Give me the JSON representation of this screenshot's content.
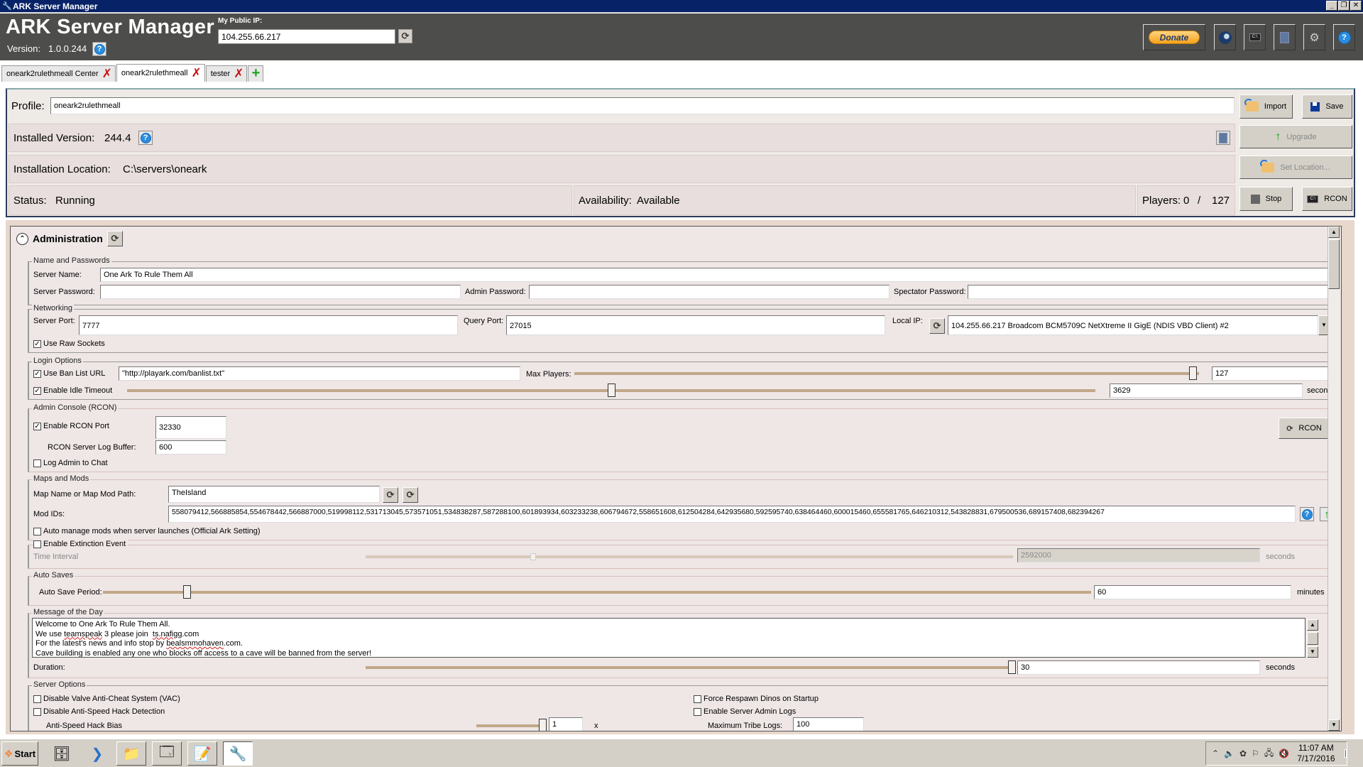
{
  "window": {
    "title": "ARK Server Manager",
    "controls": [
      "minimize",
      "restore",
      "close"
    ]
  },
  "header": {
    "app_title": "ARK Server Manager",
    "version_label": "Version:",
    "version_value": "1.0.0.244",
    "public_ip_label": "My Public IP:",
    "public_ip_value": "104.255.66.217",
    "donate_label": "Donate",
    "toolbar_icons": [
      "steam-icon",
      "console-icon",
      "notes-icon",
      "settings-icon",
      "help-icon"
    ]
  },
  "tabs": [
    {
      "label": "oneark2rulethmeall Center",
      "active": false
    },
    {
      "label": "oneark2rulethmeall",
      "active": true
    },
    {
      "label": "tester",
      "active": false
    }
  ],
  "profile": {
    "profile_label": "Profile:",
    "profile_value": "oneark2rulethmeall",
    "import_label": "Import",
    "save_label": "Save",
    "installed_version_label": "Installed Version:",
    "installed_version_value": "244.4",
    "upgrade_label": "Upgrade",
    "installation_location_label": "Installation Location:",
    "installation_location_value": "C:\\servers\\oneark",
    "set_location_label": "Set Location...",
    "status_label": "Status:",
    "status_value": "Running",
    "availability_label": "Availability:",
    "availability_value": "Available",
    "players_label": "Players:",
    "players_current": "0",
    "players_sep": "/",
    "players_max": "127",
    "stop_label": "Stop",
    "rcon_label": "RCON"
  },
  "administration": {
    "title": "Administration",
    "name_passwords": {
      "legend": "Name and Passwords",
      "server_name_label": "Server Name:",
      "server_name_value": "One Ark To Rule Them All",
      "server_password_label": "Server Password:",
      "server_password_value": "",
      "admin_password_label": "Admin Password:",
      "admin_password_value": "",
      "spectator_password_label": "Spectator Password:",
      "spectator_password_value": ""
    },
    "networking": {
      "legend": "Networking",
      "server_port_label": "Server Port:",
      "server_port_value": "7777",
      "query_port_label": "Query Port:",
      "query_port_value": "27015",
      "local_ip_label": "Local IP:",
      "local_ip_value": "104.255.66.217   Broadcom BCM5709C NetXtreme II GigE (NDIS VBD Client) #2",
      "use_raw_sockets_label": "Use Raw Sockets",
      "use_raw_sockets": true
    },
    "login_options": {
      "legend": "Login Options",
      "use_ban_list_label": "Use Ban List URL",
      "use_ban_list": true,
      "ban_list_url": "\"http://playark.com/banlist.txt\"",
      "max_players_label": "Max Players:",
      "max_players_value": "127",
      "max_players_fraction": 0.99,
      "enable_idle_timeout_label": "Enable Idle Timeout",
      "enable_idle_timeout": true,
      "idle_timeout_value": "3629",
      "idle_timeout_fraction": 0.5,
      "idle_timeout_unit": "seconds"
    },
    "rcon": {
      "legend": "Admin Console (RCON)",
      "enable_rcon_label": "Enable RCON Port",
      "enable_rcon": true,
      "rcon_port_value": "32330",
      "log_buffer_label": "RCON Server Log Buffer:",
      "log_buffer_value": "600",
      "log_admin_label": "Log Admin to Chat",
      "log_admin": false,
      "rcon_button_label": "RCON"
    },
    "maps_mods": {
      "legend": "Maps and Mods",
      "map_label": "Map Name or Map Mod Path:",
      "map_value": "TheIsland",
      "mod_ids_label": "Mod IDs:",
      "mod_ids_value": "558079412,566885854,554678442,566887000,519998112,531713045,573571051,534838287,587288100,601893934,603233238,606794672,558651608,612504284,642935680,592595740,638464460,600015460,655581765,646210312,543828831,679500536,689157408,682394267",
      "auto_manage_label": "Auto manage mods when server launches (Official Ark Setting)",
      "auto_manage": false
    },
    "extinction": {
      "enable_label": "Enable Extinction Event",
      "enabled": false,
      "time_interval_label": "Time Interval",
      "time_interval_value": "2592000",
      "time_interval_fraction": 0.26,
      "unit": "seconds"
    },
    "auto_saves": {
      "legend": "Auto Saves",
      "period_label": "Auto Save Period:",
      "period_value": "60",
      "period_fraction": 0.085,
      "unit": "minutes"
    },
    "motd": {
      "legend": "Message of the Day",
      "lines": [
        "Welcome to One Ark To Rule Them All.",
        "We use teamspeak 3 please join  ts.nafigg.com",
        "For the latest's news and info stop by bealsmmohaven.com.",
        "Cave building is enabled any one who blocks off access to a cave will be banned from the server!"
      ],
      "duration_label": "Duration:",
      "duration_value": "30",
      "duration_fraction": 1.0,
      "unit": "seconds"
    },
    "server_options": {
      "legend": "Server Options",
      "disable_vac_label": "Disable Valve Anti-Cheat System (VAC)",
      "disable_vac": false,
      "disable_speedhack_label": "Disable Anti-Speed Hack Detection",
      "disable_speedhack": false,
      "speedhack_bias_label": "Anti-Speed Hack Bias",
      "speedhack_bias_value": "1",
      "speedhack_bias_unit": "x",
      "force_respawn_label": "Force Respawn Dinos on Startup",
      "force_respawn": false,
      "enable_admin_logs_label": "Enable Server Admin Logs",
      "enable_admin_logs": false,
      "max_tribe_logs_label": "Maximum Tribe Logs:",
      "max_tribe_logs_value": "100"
    }
  },
  "taskbar": {
    "start_label": "Start",
    "apps": [
      "server-manager-icon",
      "powershell-icon",
      "explorer-icon",
      "window-icon",
      "notepad-icon",
      "ark-wrench-icon"
    ],
    "clock_time": "11:07 AM",
    "clock_date": "7/17/2016"
  }
}
